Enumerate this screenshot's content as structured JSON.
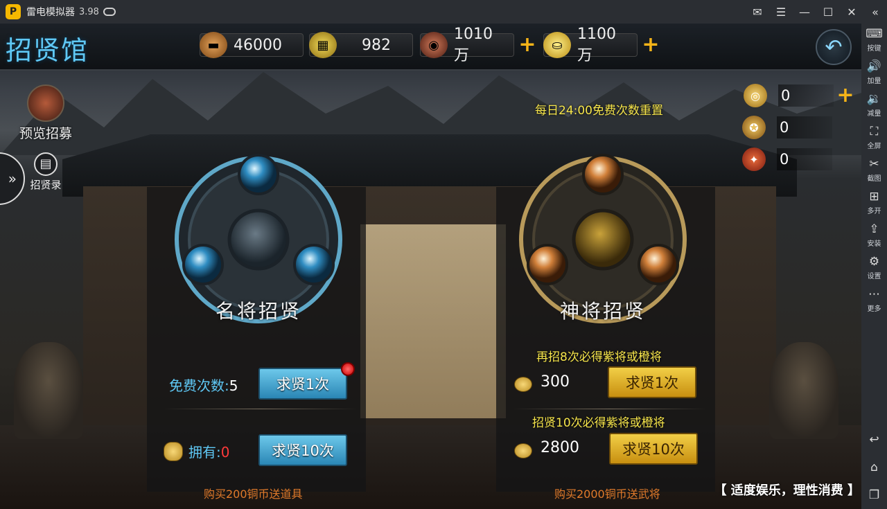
{
  "emulator": {
    "title": "雷电模拟器",
    "version": "3.98",
    "sidebar": [
      {
        "label": "按键",
        "icon": "keyboard-icon"
      },
      {
        "label": "加量",
        "icon": "volume-up-icon"
      },
      {
        "label": "减量",
        "icon": "volume-down-icon"
      },
      {
        "label": "全屏",
        "icon": "fullscreen-icon"
      },
      {
        "label": "截图",
        "icon": "scissors-icon"
      },
      {
        "label": "多开",
        "icon": "multi-instance-icon"
      },
      {
        "label": "安装",
        "icon": "apk-install-icon"
      },
      {
        "label": "设置",
        "icon": "gear-icon"
      },
      {
        "label": "更多",
        "icon": "more-icon"
      }
    ]
  },
  "header": {
    "title": "招贤馆",
    "resources": [
      {
        "name": "wood",
        "value": "46000",
        "icon": "wood-icon",
        "color": "#a86b2a"
      },
      {
        "name": "gold-bars",
        "value": "982",
        "icon": "gold-bar-icon",
        "color": "#c9a420"
      },
      {
        "name": "copper-coins",
        "value": "1010万",
        "icon": "copper-coin-icon",
        "color": "#8a3f2a"
      },
      {
        "name": "ingots",
        "value": "1100万",
        "icon": "gold-ingot-icon",
        "color": "#e8b820"
      }
    ]
  },
  "left_menu": {
    "preview_label": "预览招募",
    "record_label": "招贤录"
  },
  "reset_note": "每日24:00免费次数重置",
  "tokens": [
    {
      "value": "0",
      "icon": "gold-token-icon"
    },
    {
      "value": "0",
      "icon": "gold-bag-icon"
    },
    {
      "value": "0",
      "icon": "red-scroll-icon"
    }
  ],
  "famous": {
    "title": "名将招贤",
    "free_label": "免费次数:",
    "free_count": "5",
    "btn1": "求贤1次",
    "own_label": "拥有:",
    "own_count": "0",
    "btn10": "求贤10次",
    "promo": "购买200铜币送道具"
  },
  "divine": {
    "title": "神将招贤",
    "guarantee1": "再招8次必得紫将或橙将",
    "cost1": "300",
    "btn1": "求贤1次",
    "guarantee10": "招贤10次必得紫将或橙将",
    "cost10": "2800",
    "btn10": "求贤10次",
    "promo": "购买2000铜币送武将"
  },
  "footer_note": "【 适度娱乐，理性消费 】",
  "colors": {
    "accent_blue": "#5fc8f5",
    "gold": "#f6b418",
    "note_yellow": "#f6e54b",
    "promo_orange": "#e07a2a"
  }
}
